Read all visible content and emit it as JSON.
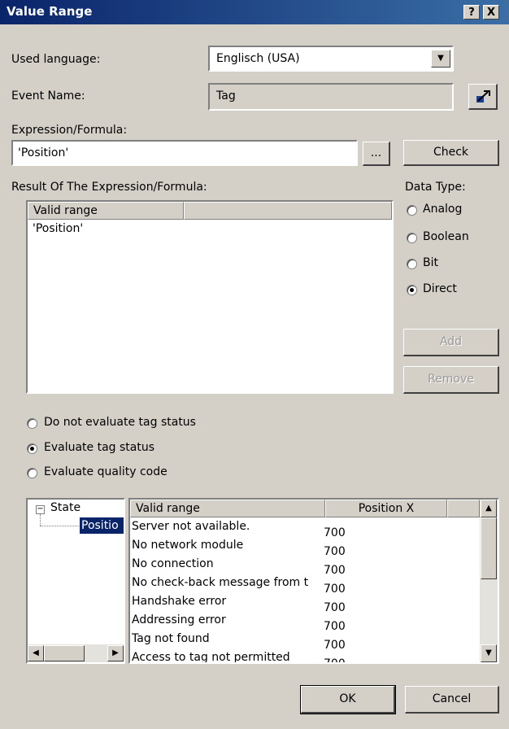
{
  "window": {
    "title": "Value Range",
    "help": "?",
    "close": "X"
  },
  "language": {
    "label": "Used language:",
    "value": "Englisch (USA)"
  },
  "event": {
    "label": "Event Name:",
    "value": "Tag"
  },
  "expression": {
    "label": "Expression/Formula:",
    "value": "'Position'",
    "browse": "...",
    "check": "Check"
  },
  "result": {
    "label": "Result Of The Expression/Formula:",
    "column_header": "Valid range",
    "rows": [
      "'Position'"
    ]
  },
  "data_type": {
    "label": "Data Type:",
    "options": [
      {
        "label": "Analog",
        "checked": false
      },
      {
        "label": "Boolean",
        "checked": false
      },
      {
        "label": "Bit",
        "checked": false
      },
      {
        "label": "Direct",
        "checked": true
      }
    ],
    "add": "Add",
    "remove": "Remove"
  },
  "tag_status": {
    "options": [
      {
        "label": "Do not evaluate tag status",
        "checked": false
      },
      {
        "label": "Evaluate tag status",
        "checked": true
      },
      {
        "label": "Evaluate quality code",
        "checked": false
      }
    ]
  },
  "tree": {
    "root": "State",
    "expander": "−",
    "child": "Positio"
  },
  "status_table": {
    "columns": [
      "Valid range",
      "Position X"
    ],
    "rows": [
      {
        "range": "Server not available.",
        "value": "700"
      },
      {
        "range": "No network module",
        "value": "700"
      },
      {
        "range": "No connection",
        "value": "700"
      },
      {
        "range": "No check-back message from t",
        "value": "700"
      },
      {
        "range": "Handshake error",
        "value": "700"
      },
      {
        "range": "Addressing error",
        "value": "700"
      },
      {
        "range": "Tag not found",
        "value": "700"
      },
      {
        "range": "Access to tag not permitted",
        "value": "700"
      }
    ]
  },
  "footer": {
    "ok": "OK",
    "cancel": "Cancel"
  }
}
